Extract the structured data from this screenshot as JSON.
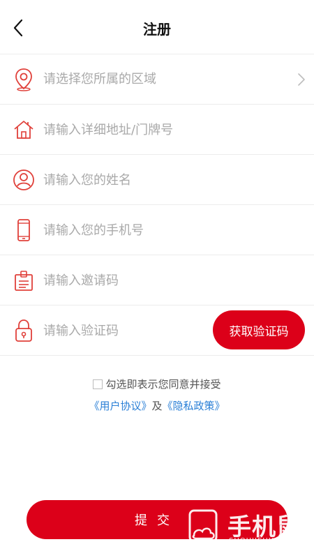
{
  "header": {
    "title": "注册"
  },
  "form": {
    "region_placeholder": "请选择您所属的区域",
    "address_placeholder": "请输入详细地址/门牌号",
    "name_placeholder": "请输入您的姓名",
    "phone_placeholder": "请输入您的手机号",
    "invite_placeholder": "请输入邀请码",
    "code_placeholder": "请输入验证码",
    "get_code_label": "获取验证码"
  },
  "agreement": {
    "text": "勾选即表示您同意并接受",
    "user_agreement": "《用户协议》",
    "and": "及",
    "privacy_policy": "《隐私政策》"
  },
  "submit_label": "提交",
  "watermark": {
    "text": "手机鼠",
    "sub": "SHOUJISHU.COM"
  },
  "colors": {
    "accent": "#dc0019",
    "link": "#2a7fd6",
    "icon": "#e0403a"
  }
}
